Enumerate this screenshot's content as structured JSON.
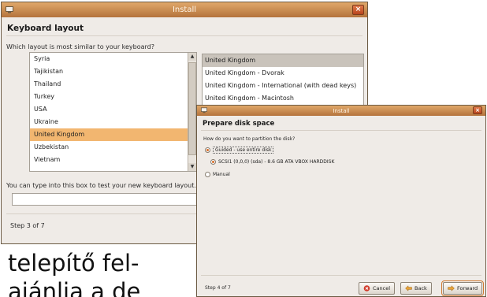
{
  "article": {
    "line1": "telepítő fel-",
    "line2": "ajánlja a de"
  },
  "keyboard_window": {
    "title": "Install",
    "close_glyph": "×",
    "heading": "Keyboard layout",
    "question": "Which layout is most similar to your keyboard?",
    "layouts": [
      "Syria",
      "Tajikistan",
      "Thailand",
      "Turkey",
      "USA",
      "Ukraine",
      "United Kingdom",
      "Uzbekistan",
      "Vietnam"
    ],
    "selected_layout": "United Kingdom",
    "variants": [
      "United Kingdom",
      "United Kingdom - Dvorak",
      "United Kingdom - International (with dead keys)",
      "United Kingdom - Macintosh"
    ],
    "selected_variant": "United Kingdom",
    "test_label": "You can type into this box to test your new keyboard layout.",
    "test_value": "",
    "step": "Step 3 of 7"
  },
  "disk_window": {
    "title": "Install",
    "close_glyph": "×",
    "heading": "Prepare disk space",
    "question": "How do you want to partition the disk?",
    "options": {
      "guided": "Guided - use entire disk",
      "disk": "SCSI1 (0,0,0) (sda) - 8.6 GB ATA VBOX HARDDISK",
      "manual": "Manual"
    },
    "selected_option": "guided",
    "step": "Step 4 of 7",
    "buttons": {
      "cancel": "Cancel",
      "back": "Back",
      "forward": "Forward"
    }
  },
  "colors": {
    "titlebar": "#c98a4d",
    "selection": "#f2b670",
    "window_bg": "#efebe7"
  },
  "icons": {
    "window": "computer-icon",
    "cancel": "cancel-icon",
    "back": "arrow-left-icon",
    "forward": "arrow-right-icon"
  }
}
